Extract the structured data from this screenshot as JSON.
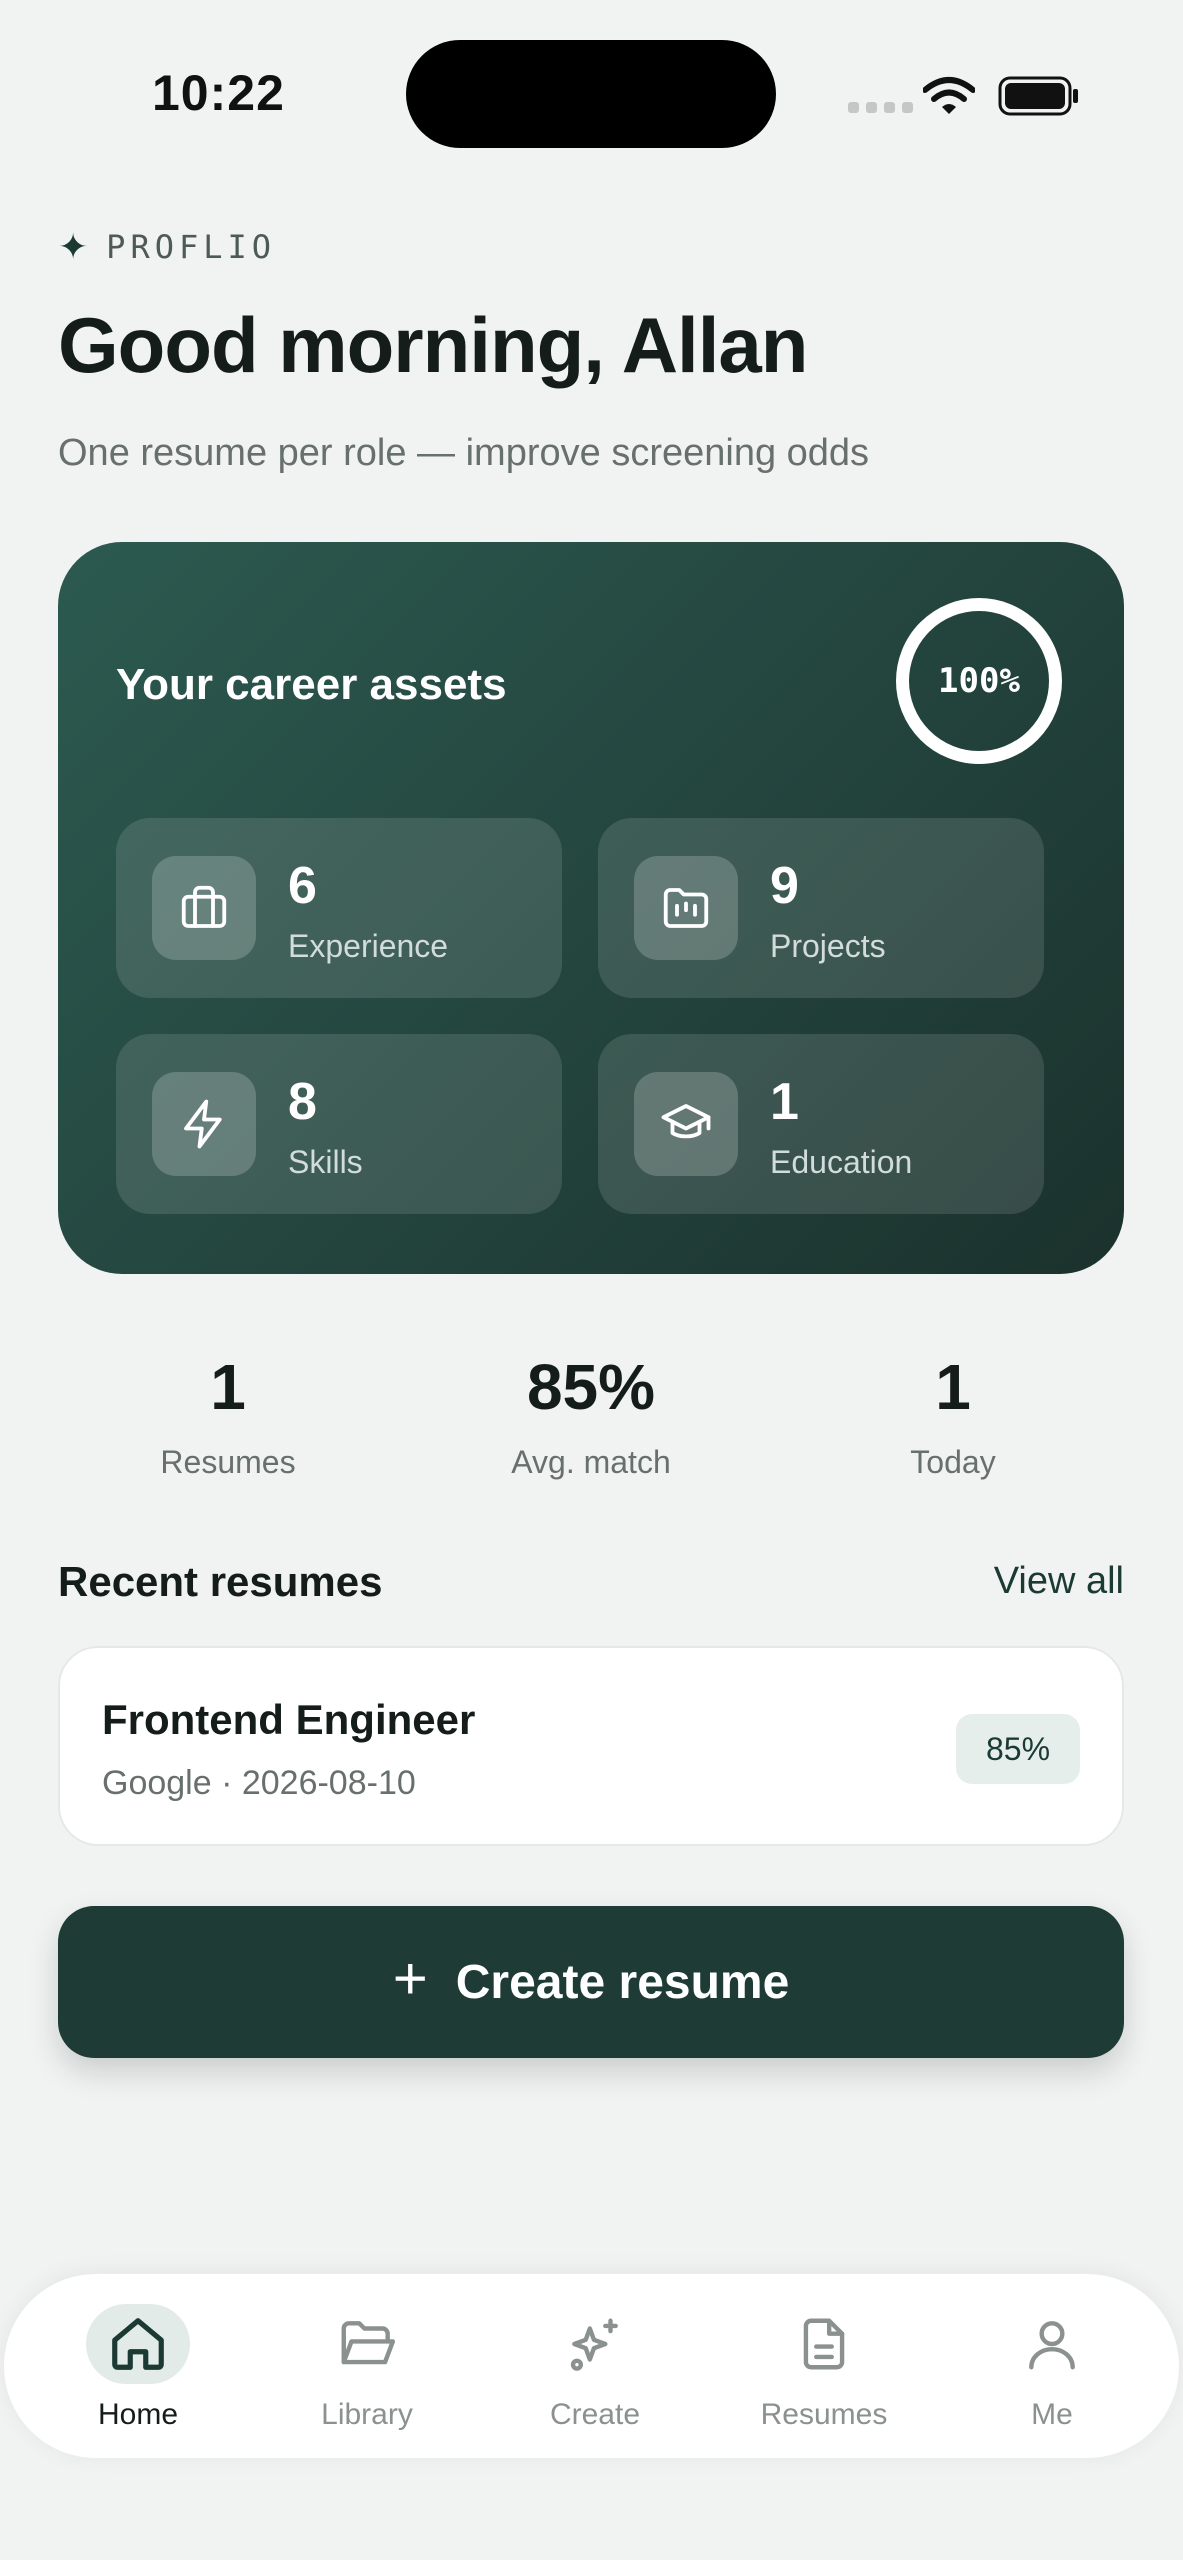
{
  "status_bar": {
    "time": "10:22"
  },
  "brand": {
    "name": "PROFLIO",
    "star_icon": "sparkle-icon"
  },
  "header": {
    "greeting": "Good morning, Allan",
    "subtitle": "One resume per role — improve screening odds"
  },
  "career_card": {
    "title": "Your career assets",
    "completion_text": "100%",
    "completion_value": 1.0,
    "assets": [
      {
        "count": "6",
        "label": "Experience",
        "icon": "briefcase-icon"
      },
      {
        "count": "9",
        "label": "Projects",
        "icon": "folder-icon"
      },
      {
        "count": "8",
        "label": "Skills",
        "icon": "lightning-icon"
      },
      {
        "count": "1",
        "label": "Education",
        "icon": "graduation-cap-icon"
      }
    ]
  },
  "stats": [
    {
      "value": "1",
      "label": "Resumes"
    },
    {
      "value": "85%",
      "label": "Avg. match"
    },
    {
      "value": "1",
      "label": "Today"
    }
  ],
  "recent": {
    "title": "Recent resumes",
    "view_all": "View all",
    "items": [
      {
        "title": "Frontend Engineer",
        "meta": "Google · 2026-08-10",
        "match": "85%"
      }
    ]
  },
  "create_button": {
    "label": "Create resume",
    "icon": "plus-icon"
  },
  "nav": {
    "active": "Home",
    "items": [
      {
        "label": "Home",
        "icon": "home-icon"
      },
      {
        "label": "Library",
        "icon": "folder-open-icon"
      },
      {
        "label": "Create",
        "icon": "sparkles-icon"
      },
      {
        "label": "Resumes",
        "icon": "document-icon"
      },
      {
        "label": "Me",
        "icon": "user-icon"
      }
    ]
  },
  "colors": {
    "background": "#f1f3f2",
    "accent_dark": "#1e3b35",
    "card_gradient_start": "#2c5a50",
    "card_gradient_end": "#1b312c",
    "text_primary": "#151d1a",
    "text_secondary": "#67706d"
  }
}
